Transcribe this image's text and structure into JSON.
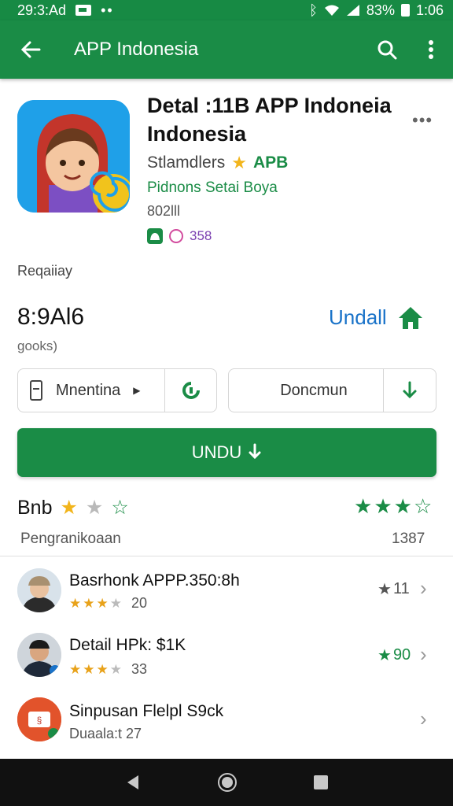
{
  "status_bar": {
    "time": "29:3:Ad",
    "battery_text": "83%",
    "clock": "1:06"
  },
  "app_bar": {
    "title": "APP Indonesia"
  },
  "app": {
    "title": "Detal :11B APP Indoneia Indonesia",
    "developer": "Stlamdlers",
    "badge": "APB",
    "category": "Pidnons Setai Boya",
    "size": "802lll",
    "mini_count": "358"
  },
  "readiness_label": "Reqaiiay",
  "price": {
    "value": "8:9Al6",
    "sub": "gooks)",
    "install_label": "Undall"
  },
  "buttons": {
    "left_label": "Mnentina",
    "right_label": "Doncmun",
    "primary_label": "UNDU"
  },
  "rating": {
    "title": "Bnb",
    "review_label": "Pengranikoaan",
    "review_count": "1387"
  },
  "list": [
    {
      "title": "Basrhonk APPP.350:8h",
      "count": "20",
      "meta": "11",
      "meta_color": "grey"
    },
    {
      "title": "Detail HPk: $1K",
      "count": "33",
      "meta": "90",
      "meta_color": "green"
    },
    {
      "title": "Sinpusan Flelpl S9ck",
      "sub": "Duaala:t 27"
    }
  ],
  "colors": {
    "primary": "#1a8c46",
    "link": "#1a73c9",
    "star": "#f2b51c"
  }
}
